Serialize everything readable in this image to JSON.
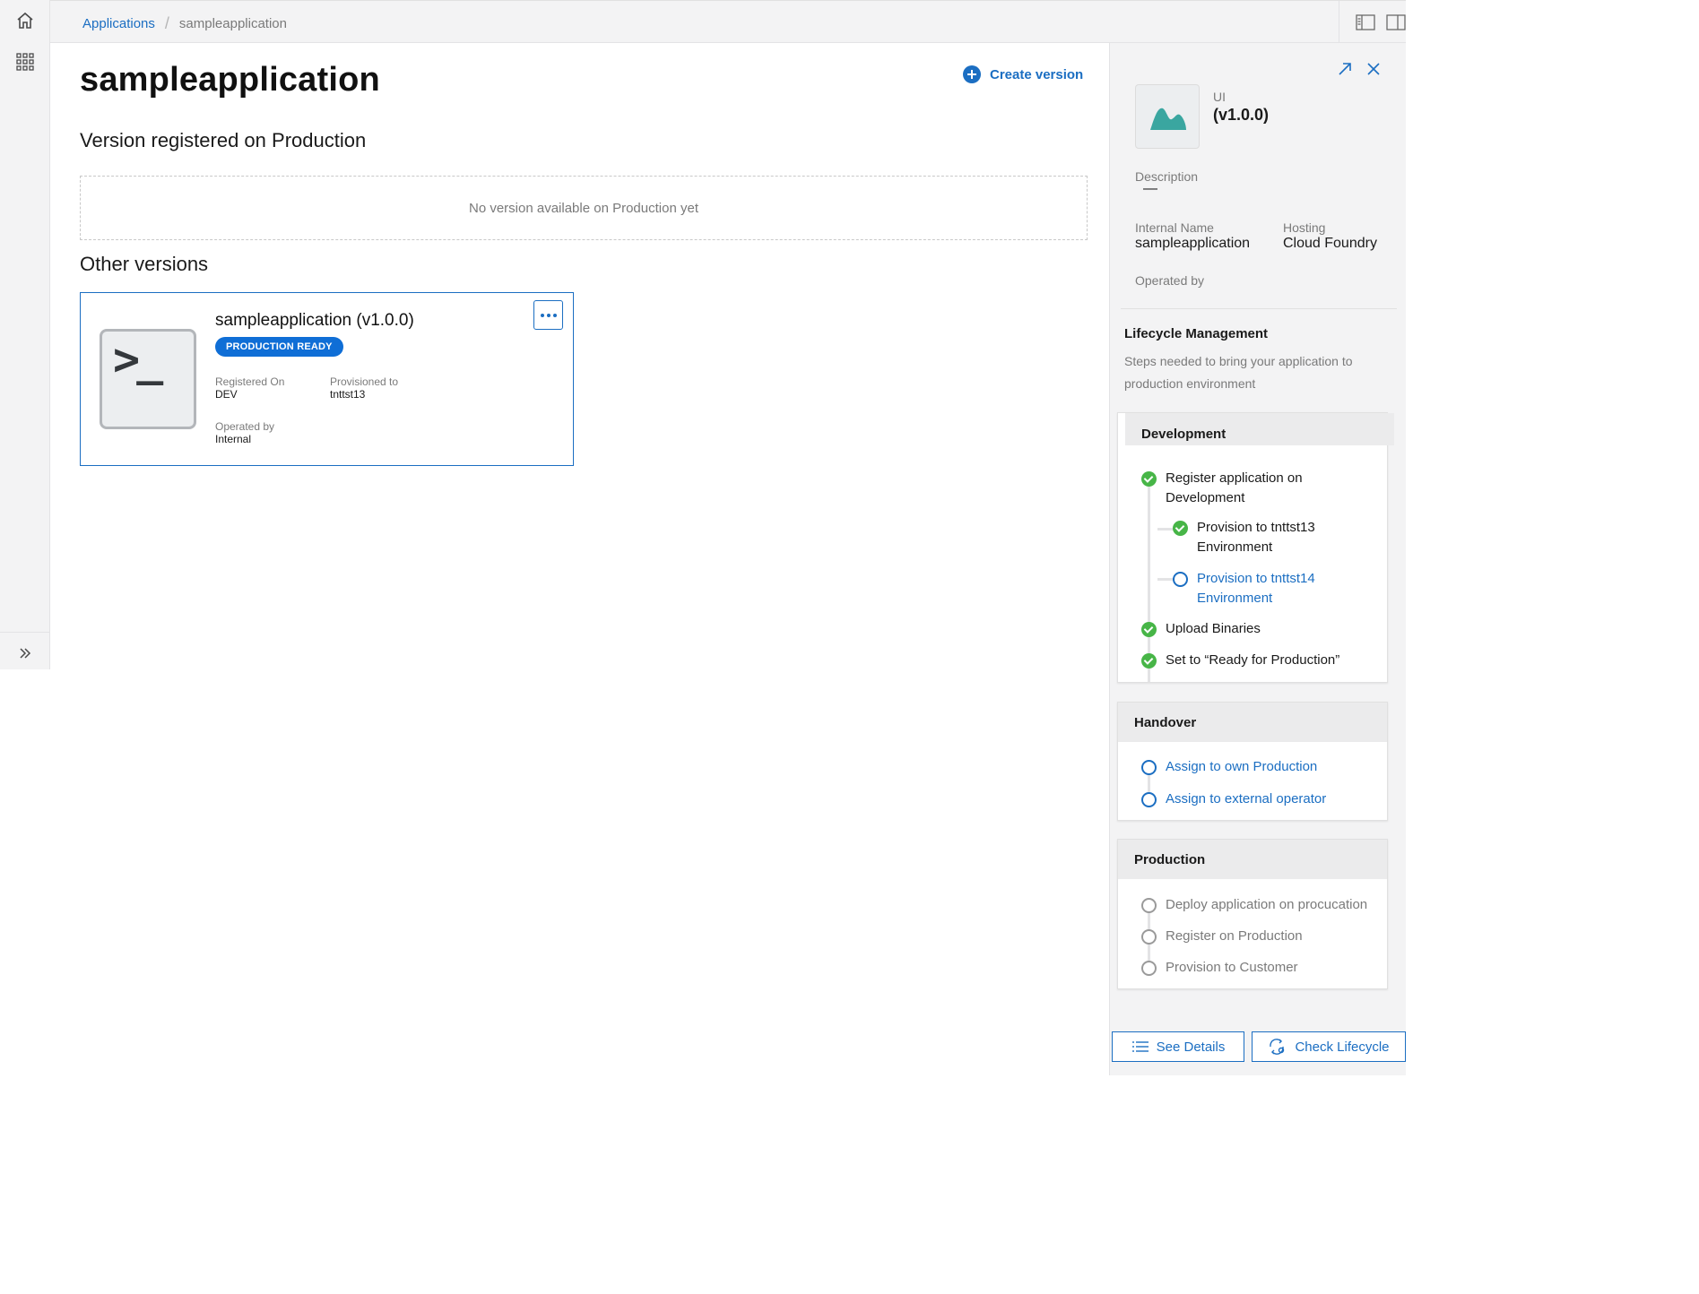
{
  "breadcrumb": {
    "root": "Applications",
    "current": "sampleapplication"
  },
  "page": {
    "title": "sampleapplication",
    "create_version_label": "Create version",
    "production_heading": "Version registered on Production",
    "production_empty": "No version available on Production yet",
    "other_heading": "Other versions"
  },
  "version_card": {
    "icon_text": ">_",
    "title": "sampleapplication (v1.0.0)",
    "status": "PRODUCTION READY",
    "registered_on_label": "Registered On",
    "registered_on": "DEV",
    "provisioned_to_label": "Provisioned to",
    "provisioned_to": "tnttst13",
    "operated_by_label": "Operated by",
    "operated_by": "Internal"
  },
  "panel": {
    "type": "UI",
    "version": "(v1.0.0)",
    "description_label": "Description",
    "description": "—",
    "internal_name_label": "Internal Name",
    "internal_name": "sampleapplication",
    "hosting_label": "Hosting",
    "hosting": "Cloud Foundry",
    "operated_by_label": "Operated by",
    "lifecycle_title": "Lifecycle Management",
    "lifecycle_subtitle": "Steps needed to bring your application to production environment",
    "stages": {
      "development": {
        "title": "Development",
        "steps": [
          {
            "label": "Register application on Development",
            "state": "done"
          },
          {
            "label": "Provision to tnttst13 Environment",
            "state": "done"
          },
          {
            "label": "Provision to tnttst14 Environment",
            "state": "open"
          },
          {
            "label": "Upload Binaries",
            "state": "done"
          },
          {
            "label": "Set to “Ready for Production”",
            "state": "done"
          }
        ]
      },
      "handover": {
        "title": "Handover",
        "steps": [
          {
            "label": "Assign to own Production",
            "state": "open"
          },
          {
            "label": "Assign to external operator",
            "state": "open"
          }
        ]
      },
      "production": {
        "title": "Production",
        "steps": [
          {
            "label": "Deploy application on procucation",
            "state": "todo"
          },
          {
            "label": "Register on Production",
            "state": "todo"
          },
          {
            "label": "Provision to Customer",
            "state": "todo"
          }
        ]
      }
    },
    "see_details_label": "See Details",
    "check_lifecycle_label": "Check Lifecycle"
  },
  "colors": {
    "accent": "#1b6ec2",
    "badge": "#0f6ed6",
    "done": "#47b547",
    "thumb_chart": "#3aa6a0"
  }
}
